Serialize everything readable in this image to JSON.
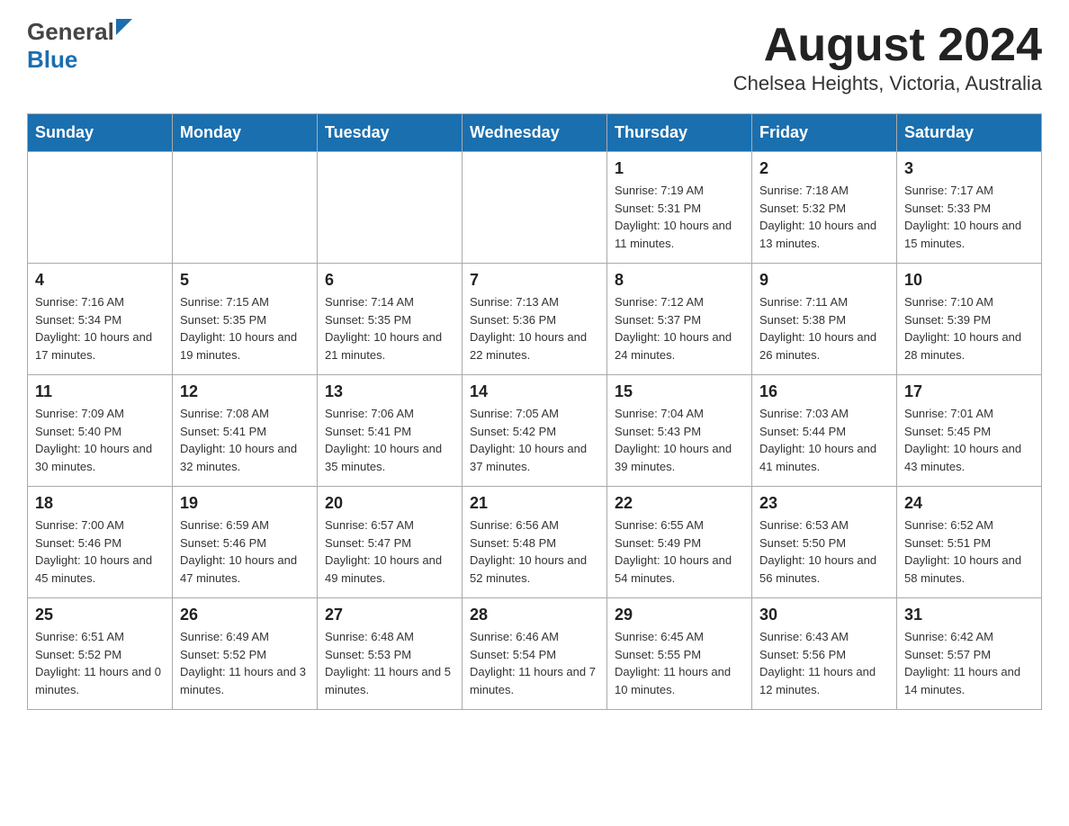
{
  "header": {
    "logo_general": "General",
    "logo_blue": "Blue",
    "title": "August 2024",
    "subtitle": "Chelsea Heights, Victoria, Australia"
  },
  "days_of_week": [
    "Sunday",
    "Monday",
    "Tuesday",
    "Wednesday",
    "Thursday",
    "Friday",
    "Saturday"
  ],
  "weeks": [
    [
      {
        "day": "",
        "info": ""
      },
      {
        "day": "",
        "info": ""
      },
      {
        "day": "",
        "info": ""
      },
      {
        "day": "",
        "info": ""
      },
      {
        "day": "1",
        "info": "Sunrise: 7:19 AM\nSunset: 5:31 PM\nDaylight: 10 hours and 11 minutes."
      },
      {
        "day": "2",
        "info": "Sunrise: 7:18 AM\nSunset: 5:32 PM\nDaylight: 10 hours and 13 minutes."
      },
      {
        "day": "3",
        "info": "Sunrise: 7:17 AM\nSunset: 5:33 PM\nDaylight: 10 hours and 15 minutes."
      }
    ],
    [
      {
        "day": "4",
        "info": "Sunrise: 7:16 AM\nSunset: 5:34 PM\nDaylight: 10 hours and 17 minutes."
      },
      {
        "day": "5",
        "info": "Sunrise: 7:15 AM\nSunset: 5:35 PM\nDaylight: 10 hours and 19 minutes."
      },
      {
        "day": "6",
        "info": "Sunrise: 7:14 AM\nSunset: 5:35 PM\nDaylight: 10 hours and 21 minutes."
      },
      {
        "day": "7",
        "info": "Sunrise: 7:13 AM\nSunset: 5:36 PM\nDaylight: 10 hours and 22 minutes."
      },
      {
        "day": "8",
        "info": "Sunrise: 7:12 AM\nSunset: 5:37 PM\nDaylight: 10 hours and 24 minutes."
      },
      {
        "day": "9",
        "info": "Sunrise: 7:11 AM\nSunset: 5:38 PM\nDaylight: 10 hours and 26 minutes."
      },
      {
        "day": "10",
        "info": "Sunrise: 7:10 AM\nSunset: 5:39 PM\nDaylight: 10 hours and 28 minutes."
      }
    ],
    [
      {
        "day": "11",
        "info": "Sunrise: 7:09 AM\nSunset: 5:40 PM\nDaylight: 10 hours and 30 minutes."
      },
      {
        "day": "12",
        "info": "Sunrise: 7:08 AM\nSunset: 5:41 PM\nDaylight: 10 hours and 32 minutes."
      },
      {
        "day": "13",
        "info": "Sunrise: 7:06 AM\nSunset: 5:41 PM\nDaylight: 10 hours and 35 minutes."
      },
      {
        "day": "14",
        "info": "Sunrise: 7:05 AM\nSunset: 5:42 PM\nDaylight: 10 hours and 37 minutes."
      },
      {
        "day": "15",
        "info": "Sunrise: 7:04 AM\nSunset: 5:43 PM\nDaylight: 10 hours and 39 minutes."
      },
      {
        "day": "16",
        "info": "Sunrise: 7:03 AM\nSunset: 5:44 PM\nDaylight: 10 hours and 41 minutes."
      },
      {
        "day": "17",
        "info": "Sunrise: 7:01 AM\nSunset: 5:45 PM\nDaylight: 10 hours and 43 minutes."
      }
    ],
    [
      {
        "day": "18",
        "info": "Sunrise: 7:00 AM\nSunset: 5:46 PM\nDaylight: 10 hours and 45 minutes."
      },
      {
        "day": "19",
        "info": "Sunrise: 6:59 AM\nSunset: 5:46 PM\nDaylight: 10 hours and 47 minutes."
      },
      {
        "day": "20",
        "info": "Sunrise: 6:57 AM\nSunset: 5:47 PM\nDaylight: 10 hours and 49 minutes."
      },
      {
        "day": "21",
        "info": "Sunrise: 6:56 AM\nSunset: 5:48 PM\nDaylight: 10 hours and 52 minutes."
      },
      {
        "day": "22",
        "info": "Sunrise: 6:55 AM\nSunset: 5:49 PM\nDaylight: 10 hours and 54 minutes."
      },
      {
        "day": "23",
        "info": "Sunrise: 6:53 AM\nSunset: 5:50 PM\nDaylight: 10 hours and 56 minutes."
      },
      {
        "day": "24",
        "info": "Sunrise: 6:52 AM\nSunset: 5:51 PM\nDaylight: 10 hours and 58 minutes."
      }
    ],
    [
      {
        "day": "25",
        "info": "Sunrise: 6:51 AM\nSunset: 5:52 PM\nDaylight: 11 hours and 0 minutes."
      },
      {
        "day": "26",
        "info": "Sunrise: 6:49 AM\nSunset: 5:52 PM\nDaylight: 11 hours and 3 minutes."
      },
      {
        "day": "27",
        "info": "Sunrise: 6:48 AM\nSunset: 5:53 PM\nDaylight: 11 hours and 5 minutes."
      },
      {
        "day": "28",
        "info": "Sunrise: 6:46 AM\nSunset: 5:54 PM\nDaylight: 11 hours and 7 minutes."
      },
      {
        "day": "29",
        "info": "Sunrise: 6:45 AM\nSunset: 5:55 PM\nDaylight: 11 hours and 10 minutes."
      },
      {
        "day": "30",
        "info": "Sunrise: 6:43 AM\nSunset: 5:56 PM\nDaylight: 11 hours and 12 minutes."
      },
      {
        "day": "31",
        "info": "Sunrise: 6:42 AM\nSunset: 5:57 PM\nDaylight: 11 hours and 14 minutes."
      }
    ]
  ]
}
